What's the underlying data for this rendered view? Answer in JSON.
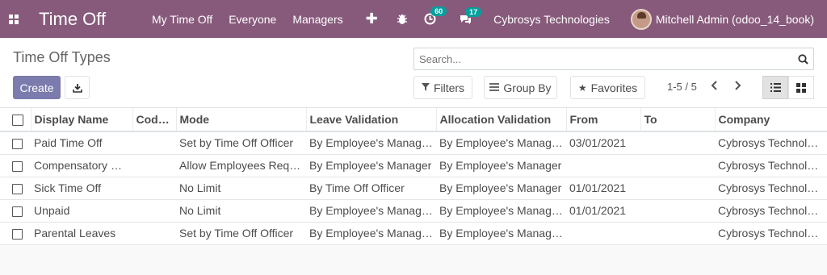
{
  "navbar": {
    "app_title": "Time Off",
    "menu": [
      "My Time Off",
      "Everyone",
      "Managers"
    ],
    "activity_count": "60",
    "message_count": "17",
    "company": "Cybrosys Technologies",
    "user": "Mitchell Admin (odoo_14_book)"
  },
  "control_panel": {
    "title": "Time Off Types",
    "search_placeholder": "Search...",
    "create_label": "Create",
    "filters_label": "Filters",
    "group_by_label": "Group By",
    "favorites_label": "Favorites",
    "pager": "1-5 / 5"
  },
  "table": {
    "columns": [
      "Display Name",
      "Code…",
      "Mode",
      "Leave Validation",
      "Allocation Validation",
      "From",
      "To",
      "Company"
    ],
    "rows": [
      [
        "Paid Time Off",
        "",
        "Set by Time Off Officer",
        "By Employee's Manager and Time Off Officer",
        "By Employee's Manager and Time Off Officer",
        "03/01/2021",
        "",
        "Cybrosys Technologies"
      ],
      [
        "Compensatory Days",
        "",
        "Allow Employees Requests",
        "By Employee's Manager",
        "By Employee's Manager",
        "",
        "",
        "Cybrosys Technologies"
      ],
      [
        "Sick Time Off",
        "",
        "No Limit",
        "By Time Off Officer",
        "By Employee's Manager",
        "01/01/2021",
        "",
        "Cybrosys Technologies"
      ],
      [
        "Unpaid",
        "",
        "No Limit",
        "By Employee's Manager and Time Off Officer",
        "By Employee's Manager and Time Off Officer",
        "01/01/2021",
        "",
        "Cybrosys Technologies"
      ],
      [
        "Parental Leaves",
        "",
        "Set by Time Off Officer",
        "By Employee's Manager and Time Off Officer",
        "By Employee's Manager and Time Off Officer",
        "",
        "",
        "Cybrosys Technologies"
      ]
    ]
  }
}
